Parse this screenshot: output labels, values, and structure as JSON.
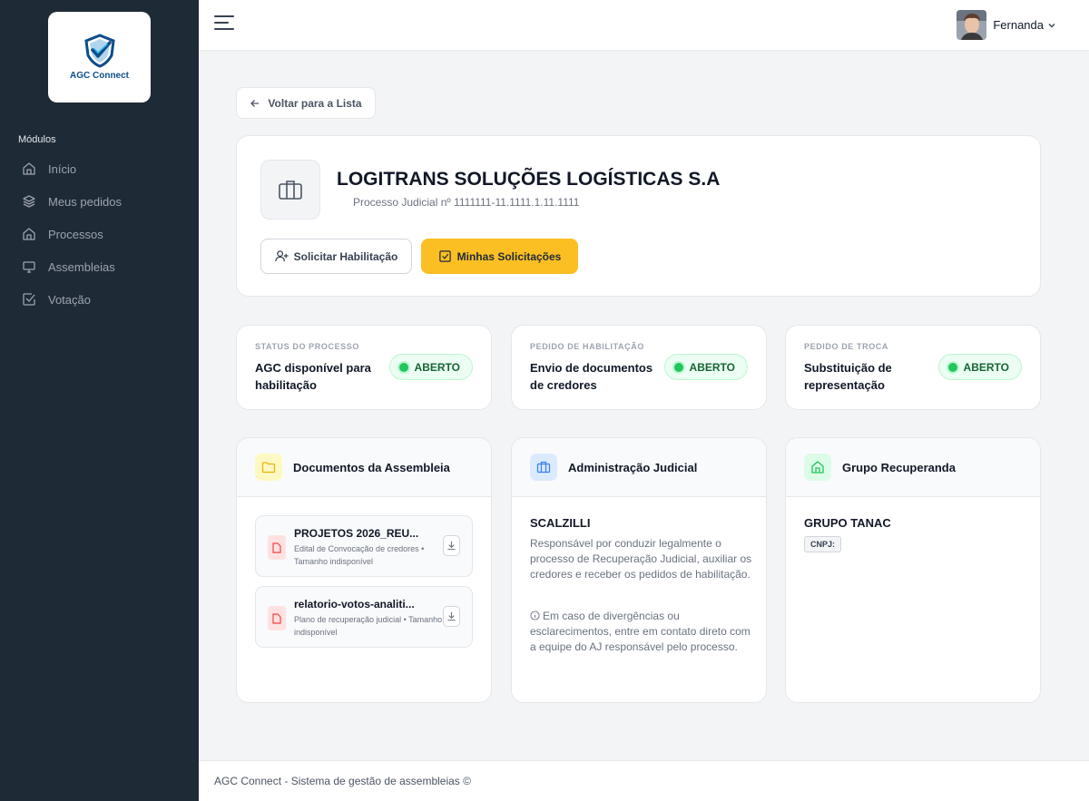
{
  "app": {
    "logo_text": "AGC Connect"
  },
  "sidebar": {
    "section_label": "Módulos",
    "items": [
      {
        "label": "Início",
        "icon": "home-icon"
      },
      {
        "label": "Meus pedidos",
        "icon": "layers-icon"
      },
      {
        "label": "Processos",
        "icon": "home-icon"
      },
      {
        "label": "Assembleias",
        "icon": "monitor-icon"
      },
      {
        "label": "Votação",
        "icon": "check-square-icon"
      }
    ]
  },
  "topbar": {
    "user_name": "Fernanda"
  },
  "back_button": "Voltar para a Lista",
  "process": {
    "company": "LOGITRANS SOLUÇÕES LOGÍSTICAS S.A",
    "subtitle": "Processo Judicial nº 1111111-11.1111.1.11.1111",
    "request_btn": "Solicitar Habilitação",
    "my_requests_btn": "Minhas Solicitações"
  },
  "status_cards": [
    {
      "label": "STATUS DO PROCESSO",
      "value": "AGC disponível para habilitação",
      "badge": "ABERTO"
    },
    {
      "label": "PEDIDO DE HABILITAÇÃO",
      "value": "Envio de documentos de credores",
      "badge": "ABERTO"
    },
    {
      "label": "PEDIDO DE TROCA",
      "value": "Substituição de representação",
      "badge": "ABERTO"
    }
  ],
  "docs_panel": {
    "title": "Documentos da Assembleia",
    "docs": [
      {
        "name": "PROJETOS 2026_REU...",
        "meta": "Edital de Convocação de credores • Tamanho indisponível"
      },
      {
        "name": "relatorio-votos-analiti...",
        "meta": "Plano de recuperação judicial • Tamanho indisponível"
      }
    ]
  },
  "admin_panel": {
    "title": "Administração Judicial",
    "name": "SCALZILLI",
    "description": "Responsável por conduzir legalmente o processo de Recuperação Judicial, auxiliar os credores e receber os pedidos de habilitação.",
    "note": "Em caso de divergências ou esclarecimentos, entre em contato direto com a equipe do AJ responsável pelo processo."
  },
  "group_panel": {
    "title": "Grupo Recuperanda",
    "name": "GRUPO TANAC",
    "cnpj_label": "CNPJ:"
  },
  "footer": "AGC Connect - Sistema de gestão de assembleias ©",
  "colors": {
    "sidebar": "#1f2a37",
    "accent": "#fbbf24",
    "success": "#22c55e"
  }
}
